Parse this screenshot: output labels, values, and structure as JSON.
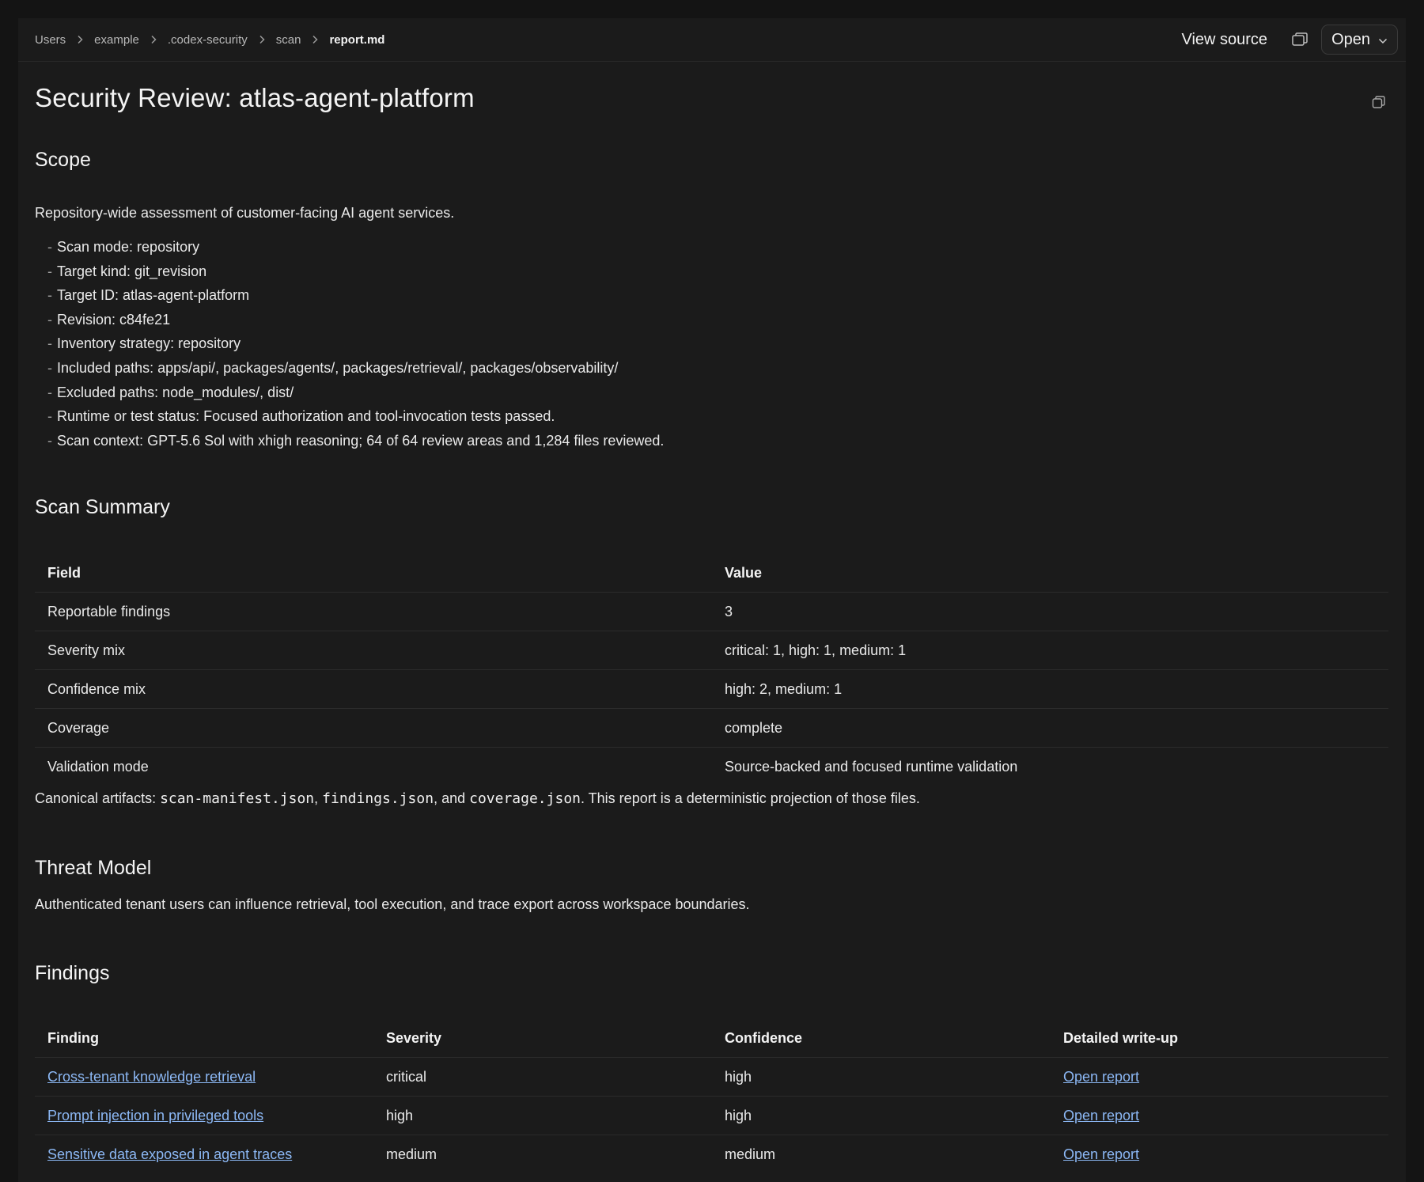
{
  "breadcrumb": [
    "Users",
    "example",
    ".codex-security",
    "scan",
    "report.md"
  ],
  "toolbar": {
    "view_source_label": "View source",
    "open_label": "Open"
  },
  "document": {
    "title": "Security Review: atlas-agent-platform",
    "scope": {
      "heading": "Scope",
      "intro": "Repository-wide assessment of customer-facing AI agent services.",
      "items": [
        "Scan mode: repository",
        "Target kind: git_revision",
        "Target ID: atlas-agent-platform",
        "Revision: c84fe21",
        "Inventory strategy: repository",
        "Included paths: apps/api/, packages/agents/, packages/retrieval/, packages/observability/",
        "Excluded paths: node_modules/, dist/",
        "Runtime or test status: Focused authorization and tool-invocation tests passed.",
        "Scan context: GPT-5.6 Sol with xhigh reasoning; 64 of 64 review areas and 1,284 files reviewed."
      ]
    },
    "summary": {
      "heading": "Scan Summary",
      "columns": [
        "Field",
        "Value"
      ],
      "rows": [
        [
          "Reportable findings",
          "3"
        ],
        [
          "Severity mix",
          "critical: 1, high: 1, medium: 1"
        ],
        [
          "Confidence mix",
          "high: 2, medium: 1"
        ],
        [
          "Coverage",
          "complete"
        ],
        [
          "Validation mode",
          "Source-backed and focused runtime validation"
        ]
      ],
      "artifacts": {
        "prefix": "Canonical artifacts: ",
        "file1": "scan-manifest.json",
        "sep1": ", ",
        "file2": "findings.json",
        "sep2": ", and ",
        "file3": "coverage.json",
        "suffix": ". This report is a deterministic projection of those files."
      }
    },
    "threat_model": {
      "heading": "Threat Model",
      "text": "Authenticated tenant users can influence retrieval, tool execution, and trace export across workspace boundaries."
    },
    "findings": {
      "heading": "Findings",
      "columns": [
        "Finding",
        "Severity",
        "Confidence",
        "Detailed write-up"
      ],
      "rows": [
        {
          "finding": "Cross-tenant knowledge retrieval",
          "severity": "critical",
          "confidence": "high",
          "writeup": "Open report"
        },
        {
          "finding": "Prompt injection in privileged tools",
          "severity": "high",
          "confidence": "high",
          "writeup": "Open report"
        },
        {
          "finding": "Sensitive data exposed in agent traces",
          "severity": "medium",
          "confidence": "medium",
          "writeup": "Open report"
        }
      ]
    }
  },
  "icons": {
    "chevron_right": "chevron-right-icon",
    "copy": "copy-icon",
    "chevron_down": "chevron-down-icon"
  },
  "colors": {
    "background": "#1b1b1b",
    "link": "#8cb8f5",
    "text": "#eaeaea"
  }
}
